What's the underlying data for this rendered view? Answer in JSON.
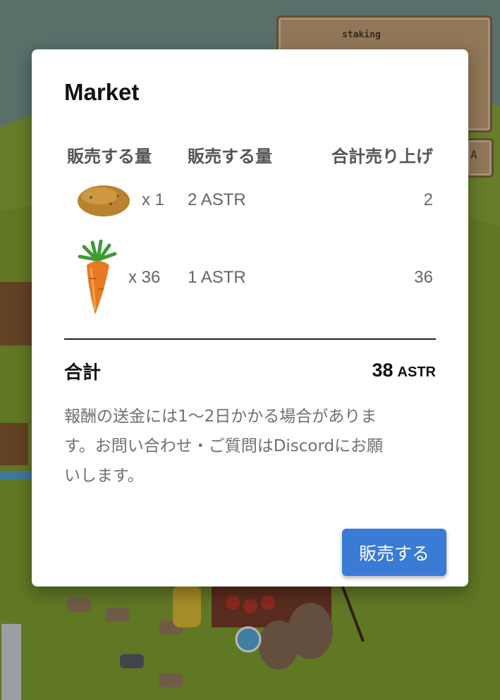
{
  "hud": {
    "staking_label": "staking",
    "token_label": "A"
  },
  "market": {
    "title": "Market",
    "headers": [
      "販売する量",
      "販売する量",
      "合計売り上げ"
    ],
    "items": [
      {
        "icon": "potato-icon",
        "quantity": "x 1",
        "price": "2 ASTR",
        "subtotal": "2"
      },
      {
        "icon": "carrot-icon",
        "quantity": "x 36",
        "price": "1 ASTR",
        "subtotal": "36"
      }
    ],
    "total_label": "合計",
    "total_value": "38",
    "total_unit": "ASTR",
    "note_line1": "報酬の送金には1〜2日かかる場合がありま",
    "note_line2": "す。お問い合わせ・ご質問はDiscordにお願",
    "note_line3": "いします。",
    "sell_button": "販売する"
  },
  "colors": {
    "accent": "#3a7bd5",
    "grass": "#8fae3a",
    "sky": "#6f8f86"
  }
}
